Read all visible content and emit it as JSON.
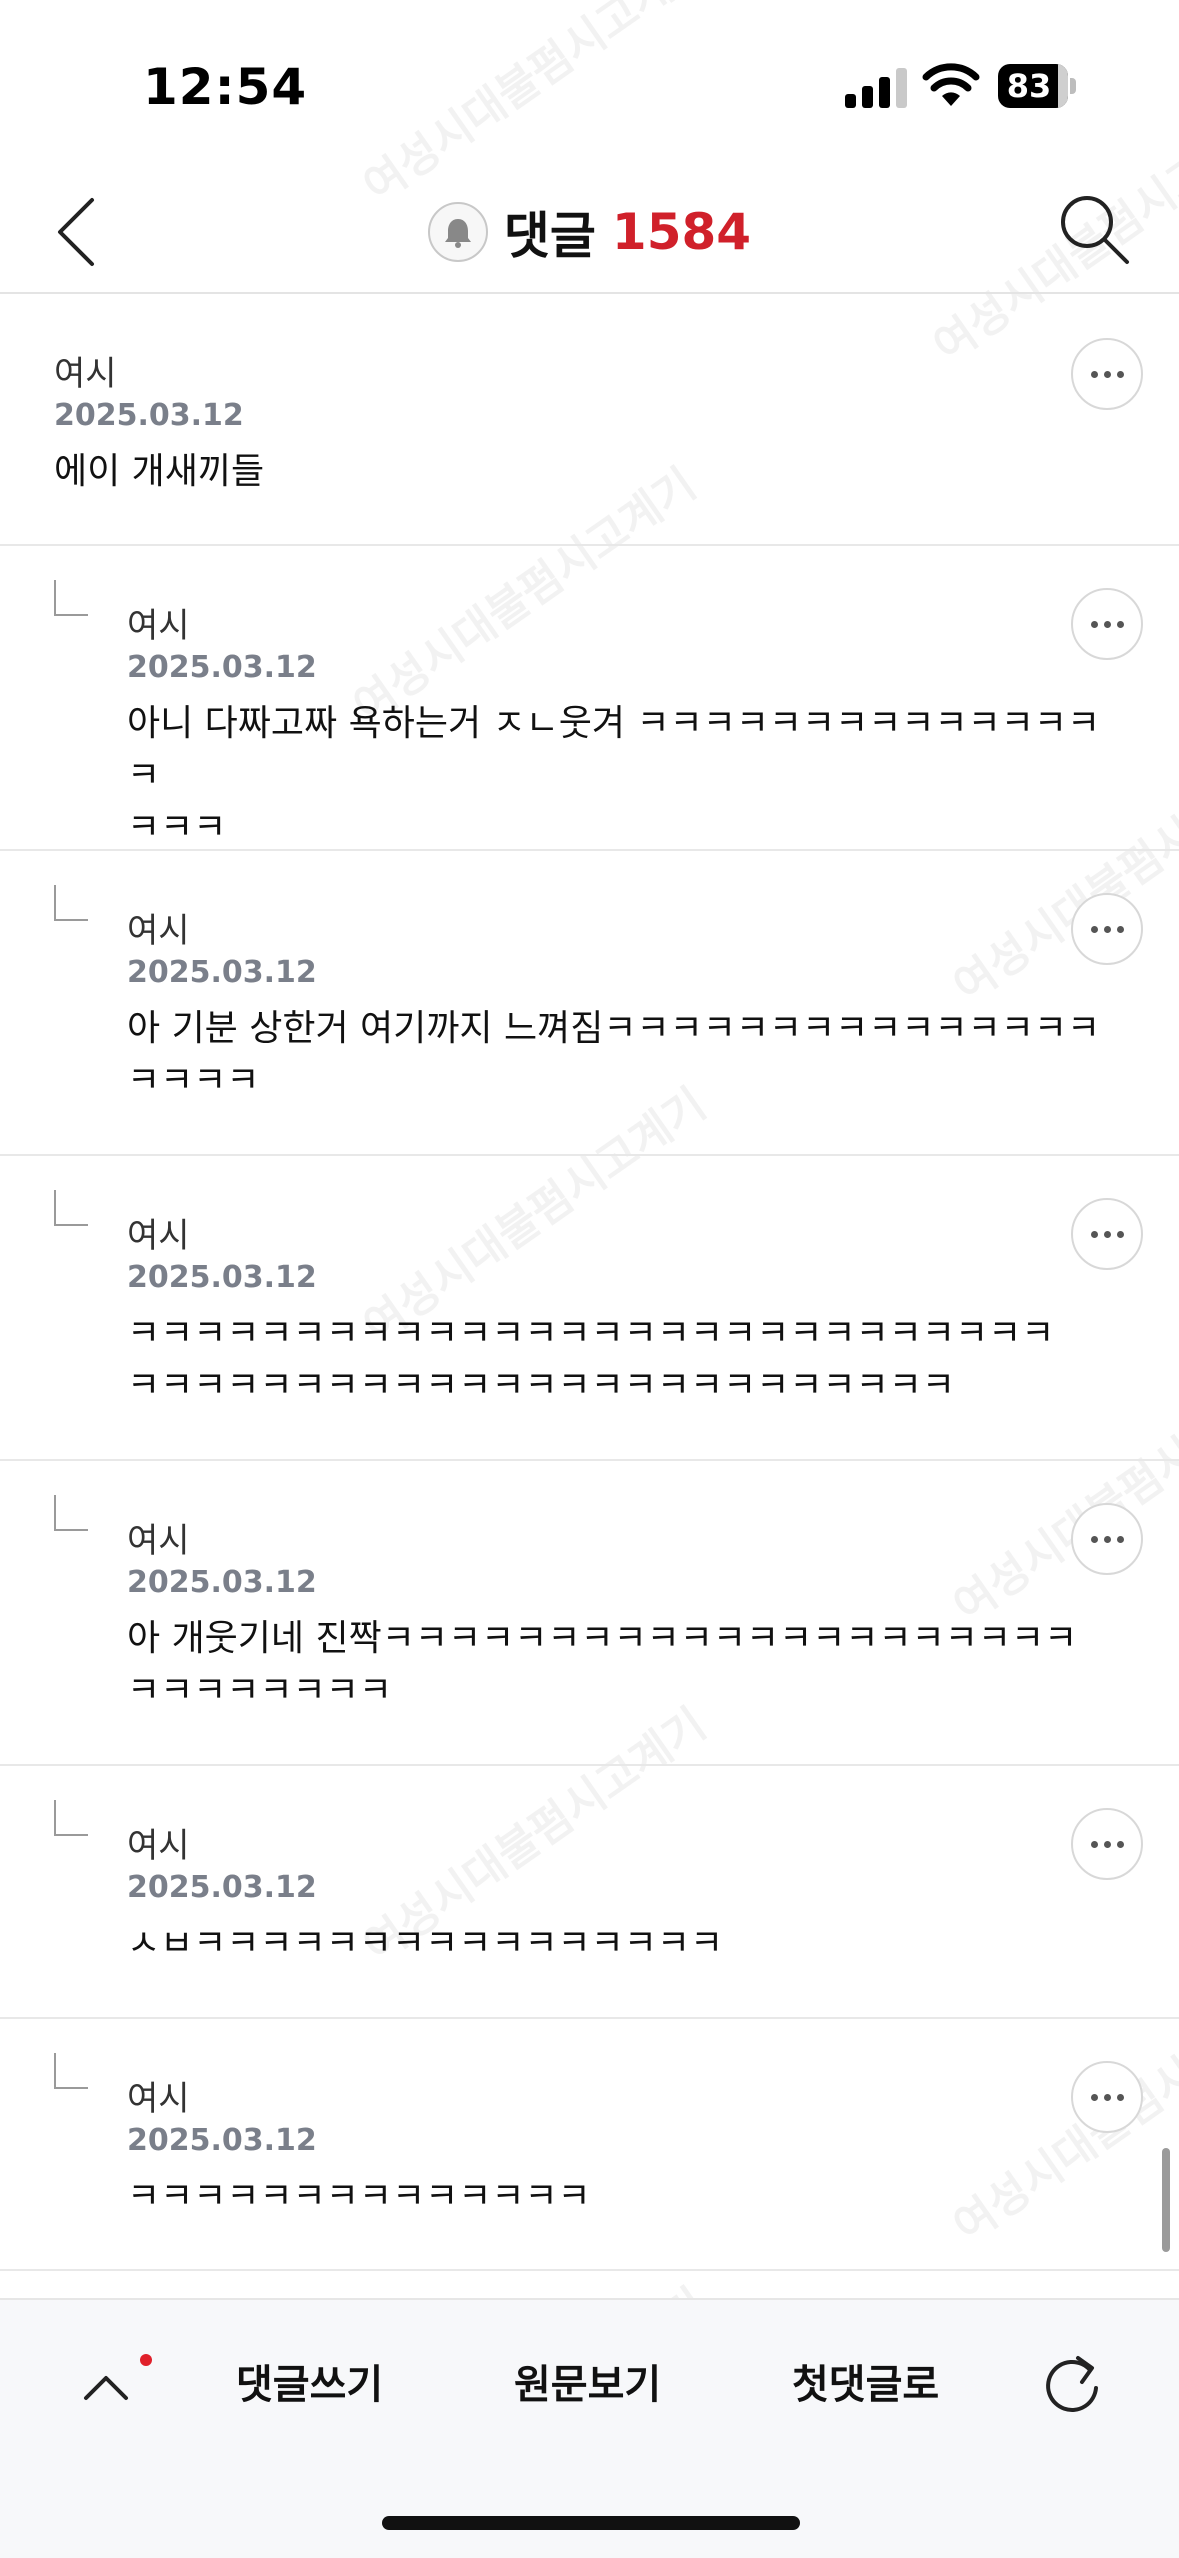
{
  "status_bar": {
    "time": "12:54",
    "battery": "83"
  },
  "header": {
    "title": "댓글",
    "count": "1584"
  },
  "comments": [
    {
      "author": "여시",
      "date": "2025.03.12",
      "text": "에이 개새끼들"
    },
    {
      "author": "여시",
      "date": "2025.03.12",
      "text": "아니 다짜고짜 욕하는거 ㅈㄴ웃겨 ㅋㅋㅋㅋㅋㅋㅋㅋㅋㅋㅋㅋㅋㅋㅋ\nㅋㅋㅋ"
    },
    {
      "author": "여시",
      "date": "2025.03.12",
      "text": "아 기분 상한거 여기까지 느껴짐ㅋㅋㅋㅋㅋㅋㅋㅋㅋㅋㅋㅋㅋㅋㅋ\nㅋㅋㅋㅋ"
    },
    {
      "author": "여시",
      "date": "2025.03.12",
      "text": "ㅋㅋㅋㅋㅋㅋㅋㅋㅋㅋㅋㅋㅋㅋㅋㅋㅋㅋㅋㅋㅋㅋㅋㅋㅋㅋㅋㅋ\nㅋㅋㅋㅋㅋㅋㅋㅋㅋㅋㅋㅋㅋㅋㅋㅋㅋㅋㅋㅋㅋㅋㅋㅋㅋ"
    },
    {
      "author": "여시",
      "date": "2025.03.12",
      "text": "아 개웃기네 진짝ㅋㅋㅋㅋㅋㅋㅋㅋㅋㅋㅋㅋㅋㅋㅋㅋㅋㅋㅋㅋㅋ\nㅋㅋㅋㅋㅋㅋㅋㅋ"
    },
    {
      "author": "여시",
      "date": "2025.03.12",
      "text": "ㅅㅂㅋㅋㅋㅋㅋㅋㅋㅋㅋㅋㅋㅋㅋㅋㅋㅋ"
    },
    {
      "author": "여시",
      "date": "2025.03.12",
      "text": "ㅋㅋㅋㅋㅋㅋㅋㅋㅋㅋㅋㅋㅋㅋ"
    }
  ],
  "bottom_bar": {
    "write": "댓글쓰기",
    "view_original": "원문보기",
    "first_comment": "첫댓글로"
  },
  "icons": [
    "back-icon",
    "bell-icon",
    "search-icon",
    "more-icon",
    "reply-icon",
    "up-arrow-icon",
    "refresh-icon"
  ],
  "colors": {
    "count": "#d0202a",
    "date": "#7a7f8a",
    "notification_dot": "#e0202a"
  }
}
